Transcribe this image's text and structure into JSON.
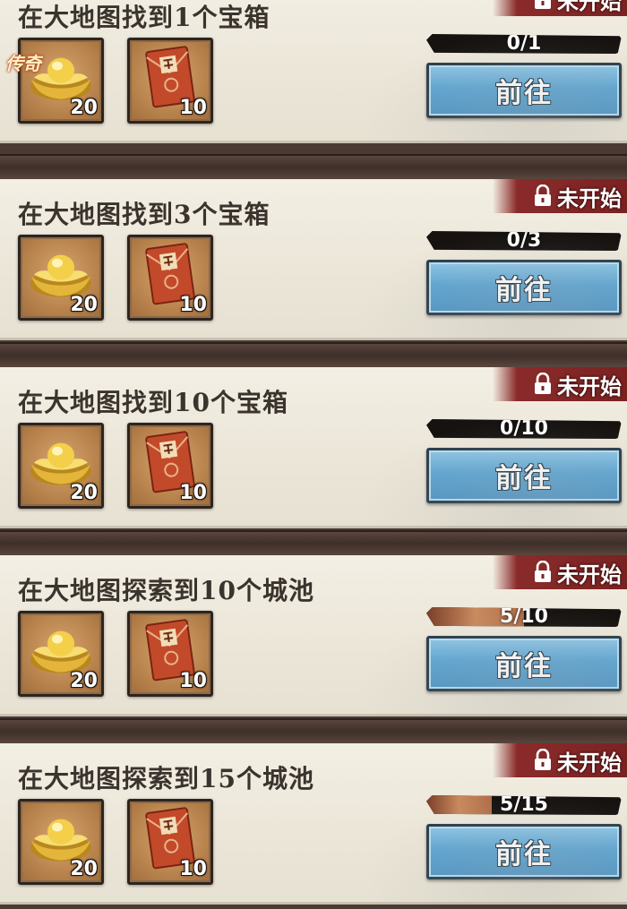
{
  "status_label": "未开始",
  "go_label": "前往",
  "logo_text": "传奇",
  "colors": {
    "status_bg": "#7a2222",
    "button_blue": "#5da5d2",
    "progress_fill": "#c98a5e",
    "card_bg": "#ebe6d8"
  },
  "tasks": [
    {
      "title": "在大地图找到1个宝箱",
      "progress_text": "0/1",
      "progress_fraction": 0,
      "rewards": [
        {
          "icon": "gold-ingot-icon",
          "qty": "20"
        },
        {
          "icon": "red-envelope-icon",
          "qty": "10"
        }
      ]
    },
    {
      "title": "在大地图找到3个宝箱",
      "progress_text": "0/3",
      "progress_fraction": 0,
      "rewards": [
        {
          "icon": "gold-ingot-icon",
          "qty": "20"
        },
        {
          "icon": "red-envelope-icon",
          "qty": "10"
        }
      ]
    },
    {
      "title": "在大地图找到10个宝箱",
      "progress_text": "0/10",
      "progress_fraction": 0,
      "rewards": [
        {
          "icon": "gold-ingot-icon",
          "qty": "20"
        },
        {
          "icon": "red-envelope-icon",
          "qty": "10"
        }
      ]
    },
    {
      "title": "在大地图探索到10个城池",
      "progress_text": "5/10",
      "progress_fraction": 0.5,
      "rewards": [
        {
          "icon": "gold-ingot-icon",
          "qty": "20"
        },
        {
          "icon": "red-envelope-icon",
          "qty": "10"
        }
      ]
    },
    {
      "title": "在大地图探索到15个城池",
      "progress_text": "5/15",
      "progress_fraction": 0.333,
      "rewards": [
        {
          "icon": "gold-ingot-icon",
          "qty": "20"
        },
        {
          "icon": "red-envelope-icon",
          "qty": "10"
        }
      ]
    }
  ]
}
